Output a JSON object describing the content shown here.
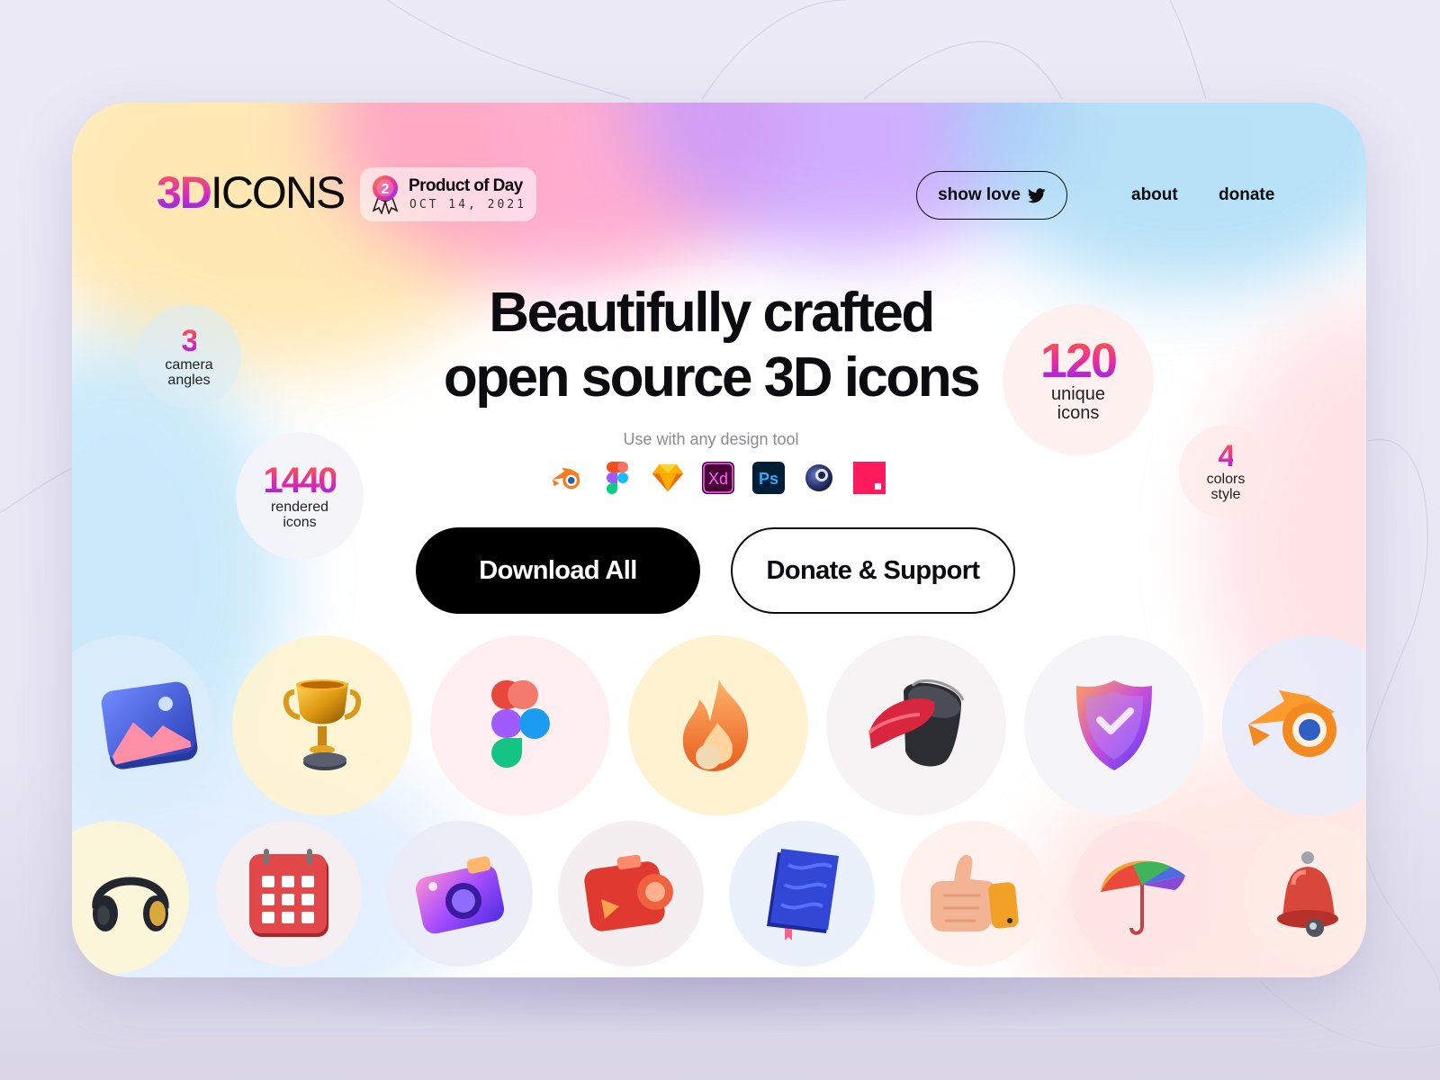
{
  "logo": {
    "part1": "3D",
    "part2": "ICONS"
  },
  "badge": {
    "rank": "2",
    "title": "Product of Day",
    "date": "OCT 14, 2021"
  },
  "nav": {
    "show_love": "show love",
    "about": "about",
    "donate": "donate"
  },
  "hero": {
    "headline_line1": "Beautifully crafted",
    "headline_line2": "open source 3D icons",
    "subtitle": "Use with any design tool"
  },
  "tools": [
    "blender-icon",
    "figma-icon",
    "sketch-icon",
    "adobe-xd-icon",
    "photoshop-icon",
    "cinema4d-icon",
    "craft-icon"
  ],
  "tool_labels": {
    "xd": "Xd",
    "ps": "Ps"
  },
  "buttons": {
    "download": "Download All",
    "donate": "Donate & Support"
  },
  "stats": {
    "camera": {
      "value": "3",
      "label_1": "camera",
      "label_2": "angles"
    },
    "rendered": {
      "value": "1440",
      "label_1": "rendered",
      "label_2": "icons"
    },
    "unique": {
      "value": "120",
      "label_1": "unique",
      "label_2": "icons"
    },
    "colors": {
      "value": "4",
      "label_1": "colors",
      "label_2": "style"
    }
  },
  "icon_grid": {
    "row1": [
      "picture-icon",
      "trophy-icon",
      "figma-3d-icon",
      "fire-icon",
      "paint-bucket-icon",
      "shield-check-icon",
      "blender-3d-icon"
    ],
    "row2": [
      "headphones-icon",
      "calendar-icon",
      "camera-icon",
      "video-camera-icon",
      "notebook-icon",
      "thumbs-up-icon",
      "umbrella-icon",
      "bell-icon"
    ]
  },
  "colors": {
    "accent_gradient_start": "#ff5f3a",
    "accent_gradient_mid": "#e92c9b",
    "accent_gradient_end": "#8c24ff",
    "primary_button": "#000000"
  }
}
